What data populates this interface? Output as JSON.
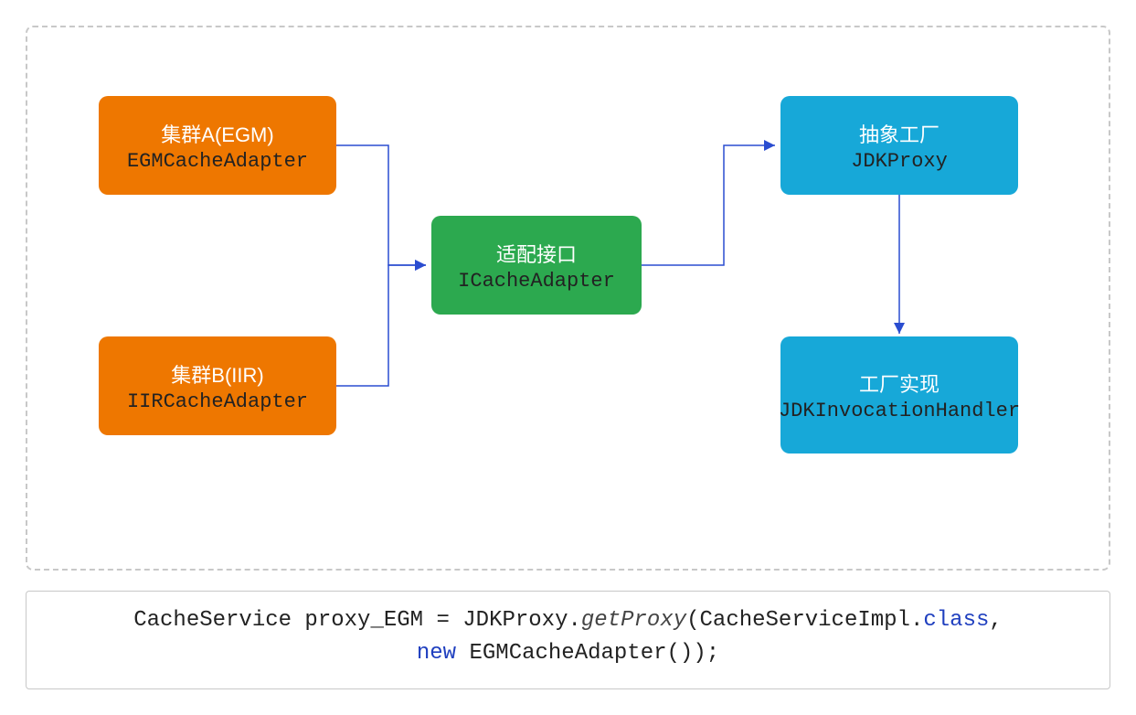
{
  "nodes": {
    "clusterA": {
      "title": "集群A(EGM)",
      "subtitle": "EGMCacheAdapter"
    },
    "clusterB": {
      "title": "集群B(IIR)",
      "subtitle": "IIRCacheAdapter"
    },
    "adapter": {
      "title": "适配接口",
      "subtitle": "ICacheAdapter"
    },
    "factory": {
      "title": "抽象工厂",
      "subtitle": "JDKProxy"
    },
    "impl": {
      "title": "工厂实现",
      "subtitle": "JDKInvocationHandler"
    }
  },
  "code": {
    "p1": "CacheService proxy_EGM = JDKProxy.",
    "p2": "getProxy",
    "p3": "(CacheServiceImpl.",
    "kw_class": "class",
    "p4": ",",
    "kw_new": "new",
    "p5": " EGMCacheAdapter());"
  }
}
